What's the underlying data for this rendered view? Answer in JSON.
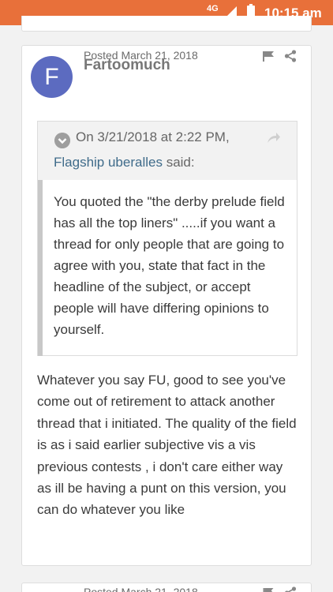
{
  "status_bar": {
    "network": "4G",
    "time": "10:15 am"
  },
  "post": {
    "avatar_letter": "F",
    "avatar_color": "#5c6bc0",
    "posted_date": "Posted March 21, 2018",
    "author": "Fartoomuch",
    "quote": {
      "date": "On 3/21/2018 at 2:22 PM,",
      "user": "Flagship uberalles",
      "said": " said:",
      "text": "You quoted the \"the derby prelude field has all the top liners\" .....if you want a thread for only people that are going to agree with you, state that fact in the headline of the subject, or accept people will have differing opinions to yourself."
    },
    "reply": "Whatever you say FU, good to see you've come out of retirement to attack another thread  that i initiated. The quality of the field is as i said earlier subjective vis a vis previous contests , i don't care either way as ill be having a punt on this version, you can do whatever you like"
  },
  "next_post": {
    "posted_date": "Posted March 21, 2018"
  },
  "colors": {
    "status_bar": "#e8703a",
    "quote_user": "#3f6b8a"
  },
  "icons": [
    "signal-icon",
    "battery-icon",
    "flag-icon",
    "share-icon",
    "chevron-down-icon",
    "goto-quote-icon"
  ]
}
